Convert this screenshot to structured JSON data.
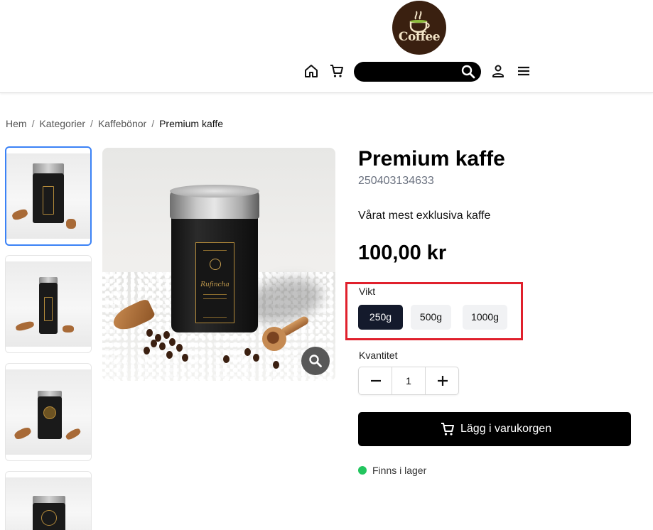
{
  "header": {
    "logo_text": "Coffee",
    "search": {
      "value": "",
      "placeholder": ""
    },
    "icons": [
      "home-icon",
      "cart-icon",
      "search-icon",
      "user-icon",
      "menu-icon"
    ]
  },
  "breadcrumb": {
    "items": [
      "Hem",
      "Kategorier",
      "Kaffebönor"
    ],
    "separator": "/",
    "current": "Premium kaffe"
  },
  "gallery": {
    "thumbnails": [
      "thumbnail-1",
      "thumbnail-2",
      "thumbnail-3",
      "thumbnail-4"
    ],
    "active_index": 0,
    "main_image_label": "Rufincha"
  },
  "product": {
    "title": "Premium kaffe",
    "sku": "250403134633",
    "description": "Vårat mest exklusiva kaffe",
    "price": "100,00 kr",
    "weight_label": "Vikt",
    "weight_options": [
      "250g",
      "500g",
      "1000g"
    ],
    "selected_weight": "250g",
    "quantity_label": "Kvantitet",
    "quantity": "1",
    "add_to_cart": "Lägg i varukorgen",
    "stock_status": "Finns i lager"
  },
  "colors": {
    "accent_dark": "#141a2c",
    "highlight": "#e0202c",
    "thumbnail_active": "#3b82f6",
    "in_stock": "#22c55e"
  }
}
